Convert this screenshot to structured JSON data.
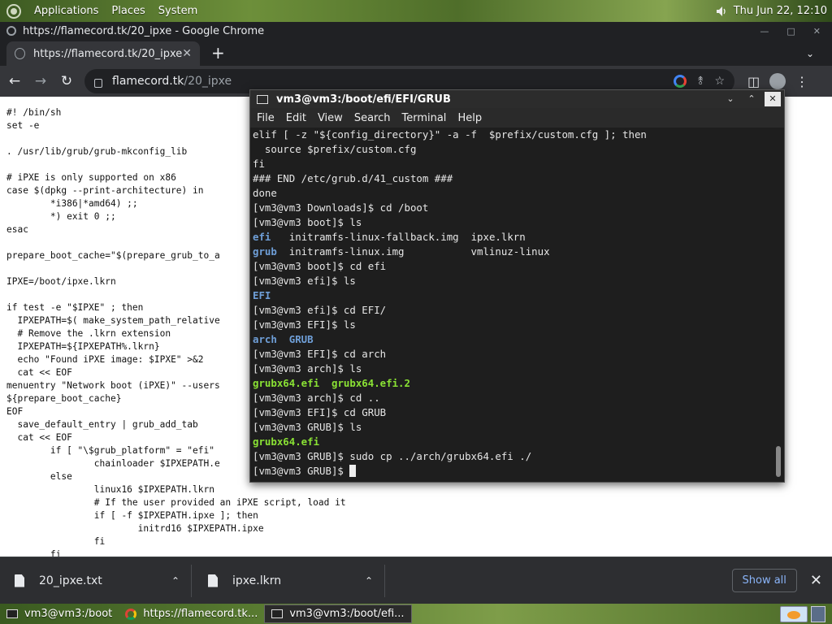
{
  "top_panel": {
    "menus": [
      "Applications",
      "Places",
      "System"
    ],
    "clock": "Thu Jun 22, 12:10",
    "icons": [
      "distro-logo-icon",
      "speaker-icon"
    ]
  },
  "chrome": {
    "window_title": "https://flamecord.tk/20_ipxe - Google Chrome",
    "tab_title": "https://flamecord.tk/20_ipxe",
    "url_host": "flamecord.tk",
    "url_path": "/20_ipxe",
    "page_lines": [
      "#! /bin/sh",
      "set -e",
      "",
      ". /usr/lib/grub/grub-mkconfig_lib",
      "",
      "# iPXE is only supported on x86",
      "case $(dpkg --print-architecture) in",
      "        *i386|*amd64) ;;",
      "        *) exit 0 ;;",
      "esac",
      "",
      "prepare_boot_cache=\"$(prepare_grub_to_a",
      "",
      "IPXE=/boot/ipxe.lkrn",
      "",
      "if test -e \"$IPXE\" ; then",
      "  IPXEPATH=$( make_system_path_relative",
      "  # Remove the .lkrn extension",
      "  IPXEPATH=${IPXEPATH%.lkrn}",
      "  echo \"Found iPXE image: $IPXE\" >&2",
      "  cat << EOF",
      "menuentry \"Network boot (iPXE)\" --users",
      "${prepare_boot_cache}",
      "EOF",
      "  save_default_entry | grub_add_tab",
      "  cat << EOF",
      "        if [ \"\\$grub_platform\" = \"efi\" ",
      "                chainloader $IPXEPATH.e",
      "        else",
      "                linux16 $IPXEPATH.lkrn",
      "                # If the user provided an iPXE script, load it",
      "                if [ -f $IPXEPATH.ipxe ]; then",
      "                        initrd16 $IPXEPATH.ipxe",
      "                fi",
      "        fi"
    ],
    "downloads": [
      {
        "name": "20_ipxe.txt"
      },
      {
        "name": "ipxe.lkrn"
      }
    ],
    "show_all": "Show all"
  },
  "terminal": {
    "title": "vm3@vm3:/boot/efi/EFI/GRUB",
    "menu": [
      "File",
      "Edit",
      "View",
      "Search",
      "Terminal",
      "Help"
    ],
    "lines": [
      [
        {
          "t": "elif [ -z \"${config_directory}\" -a -f  $prefix/custom.cfg ]; then"
        }
      ],
      [
        {
          "t": "  source $prefix/custom.cfg"
        }
      ],
      [
        {
          "t": "fi"
        }
      ],
      [
        {
          "t": "### END /etc/grub.d/41_custom ###"
        }
      ],
      [
        {
          "t": "done"
        }
      ],
      [
        {
          "t": "[vm3@vm3 Downloads]$ cd /boot"
        }
      ],
      [
        {
          "t": "[vm3@vm3 boot]$ ls"
        }
      ],
      [
        {
          "t": "efi",
          "c": "blue"
        },
        {
          "t": "   initramfs-linux-fallback.img  ipxe.lkrn"
        }
      ],
      [
        {
          "t": "grub",
          "c": "blue"
        },
        {
          "t": "  initramfs-linux.img           vmlinuz-linux"
        }
      ],
      [
        {
          "t": "[vm3@vm3 boot]$ cd efi"
        }
      ],
      [
        {
          "t": "[vm3@vm3 efi]$ ls"
        }
      ],
      [
        {
          "t": "EFI",
          "c": "blue"
        }
      ],
      [
        {
          "t": "[vm3@vm3 efi]$ cd EFI/"
        }
      ],
      [
        {
          "t": "[vm3@vm3 EFI]$ ls"
        }
      ],
      [
        {
          "t": "arch",
          "c": "blue"
        },
        {
          "t": "  "
        },
        {
          "t": "GRUB",
          "c": "blue"
        }
      ],
      [
        {
          "t": "[vm3@vm3 EFI]$ cd arch"
        }
      ],
      [
        {
          "t": "[vm3@vm3 arch]$ ls"
        }
      ],
      [
        {
          "t": "grubx64.efi",
          "c": "green"
        },
        {
          "t": "  "
        },
        {
          "t": "grubx64.efi.2",
          "c": "green"
        }
      ],
      [
        {
          "t": "[vm3@vm3 arch]$ cd .."
        }
      ],
      [
        {
          "t": "[vm3@vm3 EFI]$ cd GRUB"
        }
      ],
      [
        {
          "t": "[vm3@vm3 GRUB]$ ls"
        }
      ],
      [
        {
          "t": "grubx64.efi",
          "c": "green"
        }
      ],
      [
        {
          "t": "[vm3@vm3 GRUB]$ sudo cp ../arch/grubx64.efi ./"
        }
      ],
      [
        {
          "t": "[vm3@vm3 GRUB]$ "
        },
        {
          "cursor": true
        }
      ]
    ]
  },
  "taskbar": {
    "tasks": [
      {
        "label": "vm3@vm3:/boot",
        "icon": "terminal-icon",
        "active": false
      },
      {
        "label": "https://flamecord.tk...",
        "icon": "chrome-icon",
        "active": false
      },
      {
        "label": "vm3@vm3:/boot/efi...",
        "icon": "terminal-icon",
        "active": true
      }
    ]
  }
}
